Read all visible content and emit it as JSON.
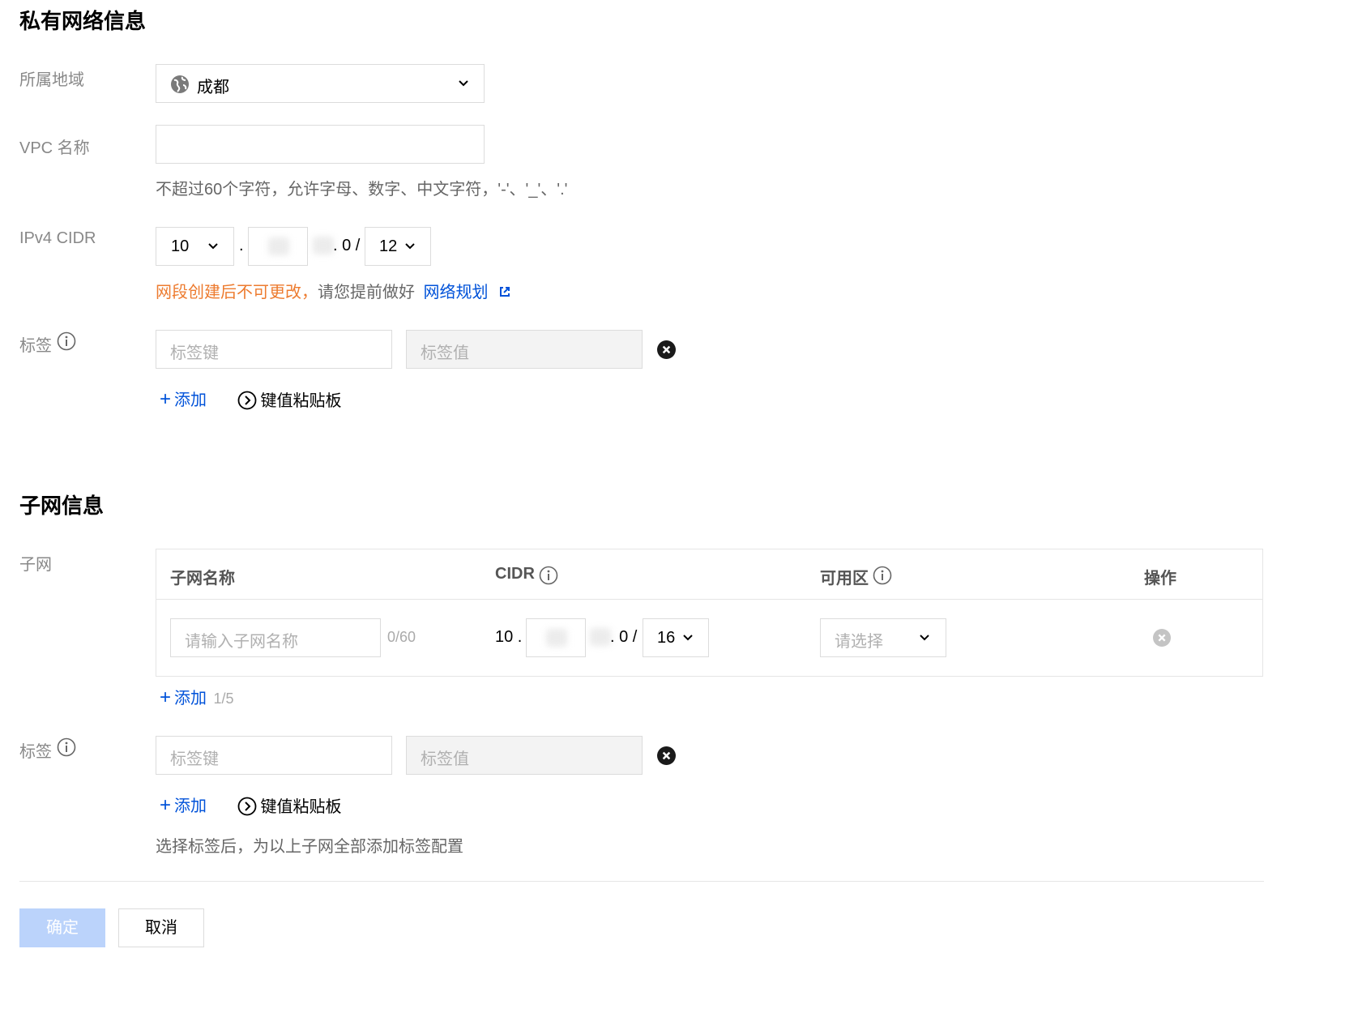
{
  "vpc_section": {
    "title": "私有网络信息",
    "region": {
      "label": "所属地域",
      "value": "成都"
    },
    "vpc_name": {
      "label": "VPC 名称",
      "value": "",
      "help": "不超过60个字符，允许字母、数字、中文字符，'-'、'_'、'.'"
    },
    "cidr": {
      "label": "IPv4 CIDR",
      "octet1": "10",
      "dot": ".",
      "suffix": ". 0 /",
      "mask": "12",
      "warning": "网段创建后不可更改，",
      "hint": "请您提前做好",
      "plan_link": "网络规划"
    },
    "tags": {
      "label": "标签",
      "key_placeholder": "标签键",
      "value_placeholder": "标签值",
      "add": "添加",
      "clipboard": "键值粘贴板"
    }
  },
  "subnet_section": {
    "title": "子网信息",
    "subnet_label": "子网",
    "table": {
      "headers": {
        "name": "子网名称",
        "cidr": "CIDR",
        "zone": "可用区",
        "action": "操作"
      },
      "row": {
        "name_placeholder": "请输入子网名称",
        "name_count": "0/60",
        "cidr_prefix": "10 .",
        "cidr_suffix": ". 0 /",
        "mask": "16",
        "zone_placeholder": "请选择"
      }
    },
    "add": "添加",
    "add_count": "1/5",
    "tags": {
      "label": "标签",
      "key_placeholder": "标签键",
      "value_placeholder": "标签值",
      "add": "添加",
      "clipboard": "键值粘贴板",
      "help": "选择标签后，为以上子网全部添加标签配置"
    }
  },
  "footer": {
    "confirm": "确定",
    "cancel": "取消"
  },
  "colors": {
    "accent": "#0052d9",
    "warning": "#ed7b2f",
    "confirm_disabled": "#bbd3fb"
  }
}
